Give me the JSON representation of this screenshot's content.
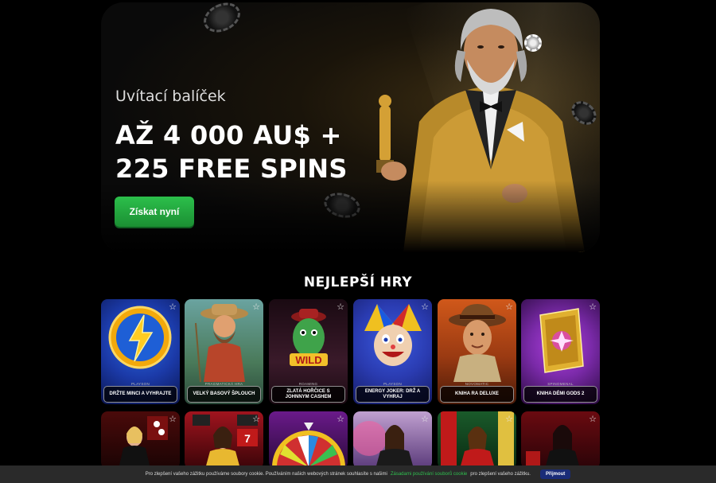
{
  "hero": {
    "subtitle": "Uvítací balíček",
    "title_line1": "AŽ 4 000 AU$ +",
    "title_line2": "225 FREE SPINS",
    "cta_label": "Získat nyní"
  },
  "section": {
    "title": "NEJLEPŠÍ HRY"
  },
  "games": [
    {
      "provider": "PLAYSON",
      "name": "DRŽTE MINCI A VYHRAJTE",
      "bg1": "#1b3aa8",
      "bg2": "#0a1550",
      "accent": "#f2a90c",
      "icon": "lightning-coin-icon"
    },
    {
      "provider": "PRAGMATICKÁ HRA",
      "name": "VELKÝ BASOVÝ ŠPLOUCH",
      "bg1": "#6aa3a0",
      "bg2": "#2b4a3a",
      "accent": "#b8452a",
      "icon": "fisherman-icon"
    },
    {
      "provider": "ROAMING",
      "name": "ZLATÁ HOŘČICE S JOHNNYM CASHEM",
      "bg1": "#3a1a2a",
      "bg2": "#1a0a12",
      "accent": "#3fa34a",
      "icon": "wild-pepper-icon"
    },
    {
      "provider": "PLAYSON",
      "name": "ENERGY JOKER: DRŽ A VYHRAJ",
      "bg1": "#2a3bb0",
      "bg2": "#141c66",
      "accent": "#f0c020",
      "icon": "joker-icon"
    },
    {
      "provider": "NOVOMATIC",
      "name": "KNIHA RA DELUXE",
      "bg1": "#c0481a",
      "bg2": "#4a1a08",
      "accent": "#e08a30",
      "icon": "adventurer-icon"
    },
    {
      "provider": "SPINOMENAL",
      "name": "KNIHA DÉMI GODS 2",
      "bg1": "#7a2aa8",
      "bg2": "#2a0a40",
      "accent": "#e0b030",
      "icon": "golden-book-icon"
    }
  ],
  "live_games": [
    {
      "bg1": "#4a0a0a",
      "bg2": "#1a0404",
      "icon": "live-dealer-icon"
    },
    {
      "bg1": "#a0141e",
      "bg2": "#3a0408",
      "icon": "live-dealer-icon"
    },
    {
      "bg1": "#6a1a8a",
      "bg2": "#2a0a3a",
      "icon": "wheel-icon"
    },
    {
      "bg1": "#c0a0d0",
      "bg2": "#5a3a7a",
      "icon": "live-dealer-icon"
    },
    {
      "bg1": "#1a5a2a",
      "bg2": "#0a2a12",
      "icon": "live-dealer-icon"
    },
    {
      "bg1": "#6a0a10",
      "bg2": "#2a0408",
      "icon": "live-dealer-icon"
    }
  ],
  "cookie": {
    "text1": "Pro zlepšení vašeho zážitku používáme soubory cookie. Používáním našich webových stránek souhlasíte s našimi",
    "link": "Zásadami používání souborů cookie",
    "text2": "pro zlepšení vašeho zážitku.",
    "accept": "Přijmout"
  }
}
